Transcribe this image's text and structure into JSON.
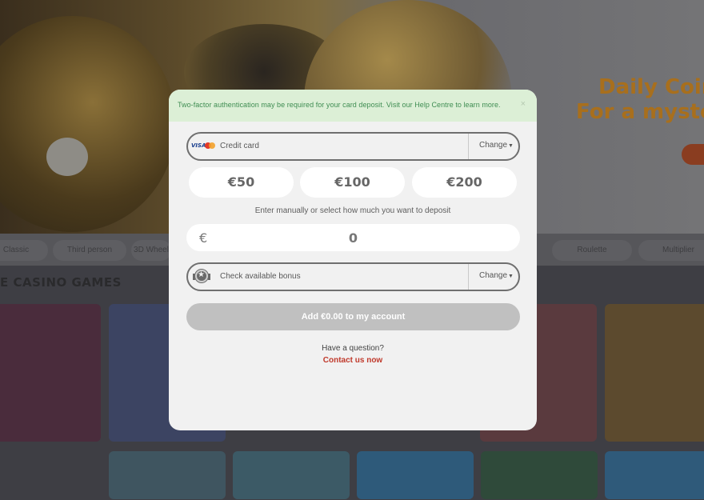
{
  "background": {
    "hero_title_line1": "Daily Coin ",
    "hero_title_line2": "For a mystery",
    "categories": [
      "Classic",
      "Third person",
      "3D Wheel",
      "Roulette",
      "Multiplier"
    ],
    "section_title": "E CASINO GAMES"
  },
  "modal": {
    "notice": "Two-factor authentication may be required for your card deposit. Visit our Help Centre to learn more.",
    "close_label": "×",
    "payment": {
      "brand_visa": "VISA",
      "label": "Credit card",
      "change_label": "Change"
    },
    "amount_options": [
      "€50",
      "€100",
      "€200"
    ],
    "hint": "Enter manually or select how much you want to deposit",
    "amount_input": {
      "currency": "€",
      "value": "0"
    },
    "bonus": {
      "label": "Check available bonus",
      "change_label": "Change"
    },
    "submit_label": "Add €0.00 to my account",
    "question": "Have a question?",
    "contact_label": "Contact us now"
  },
  "colors": {
    "notice_bg": "#dcefd6",
    "notice_text": "#3f8d52",
    "contact": "#c0392b",
    "submit_disabled": "#c0c0c0"
  },
  "icons": [
    "visa-icon",
    "mastercard-icon",
    "bonus-star-icon",
    "close-icon",
    "caret-down-icon"
  ]
}
